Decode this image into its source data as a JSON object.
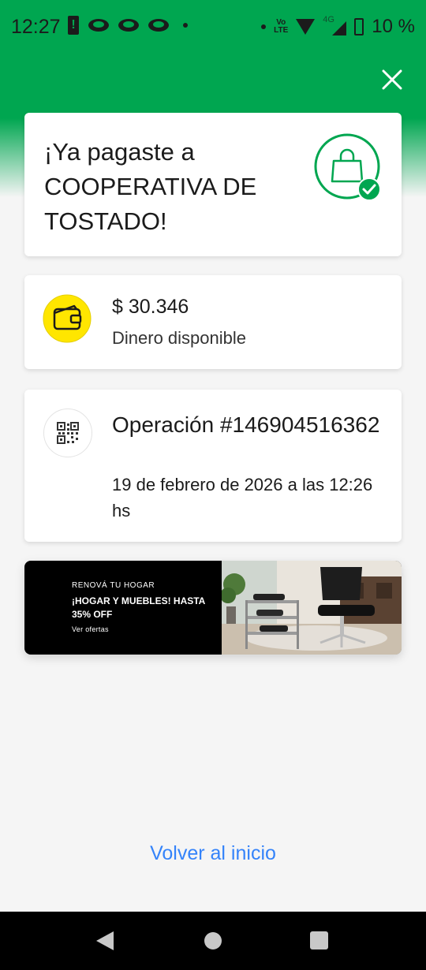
{
  "status_bar": {
    "time": "12:27",
    "volte_top": "Vo",
    "volte_bottom": "LTE",
    "network": "4G",
    "battery": "10 %"
  },
  "success_card": {
    "title": "¡Ya pagaste a COOPERATIVA DE TOSTADO!"
  },
  "balance_card": {
    "amount": "$ 30.346",
    "label": "Dinero disponible"
  },
  "operation_card": {
    "title": "Operación #146904516362",
    "date": "19 de febrero de 2026 a las 12:26 hs"
  },
  "banner": {
    "eyebrow": "RENOVÁ TU HOGAR",
    "headline": "¡HOGAR Y MUEBLES! HASTA 35% OFF",
    "cta": "Ver ofertas"
  },
  "footer": {
    "home_link": "Volver al inicio"
  },
  "colors": {
    "brand_green": "#00a650",
    "link_blue": "#3483fa",
    "wallet_yellow": "#ffe600"
  },
  "icons": {
    "close": "close-icon",
    "bag": "shopping-bag-check-icon",
    "wallet": "wallet-icon",
    "qr": "qr-code-icon"
  }
}
